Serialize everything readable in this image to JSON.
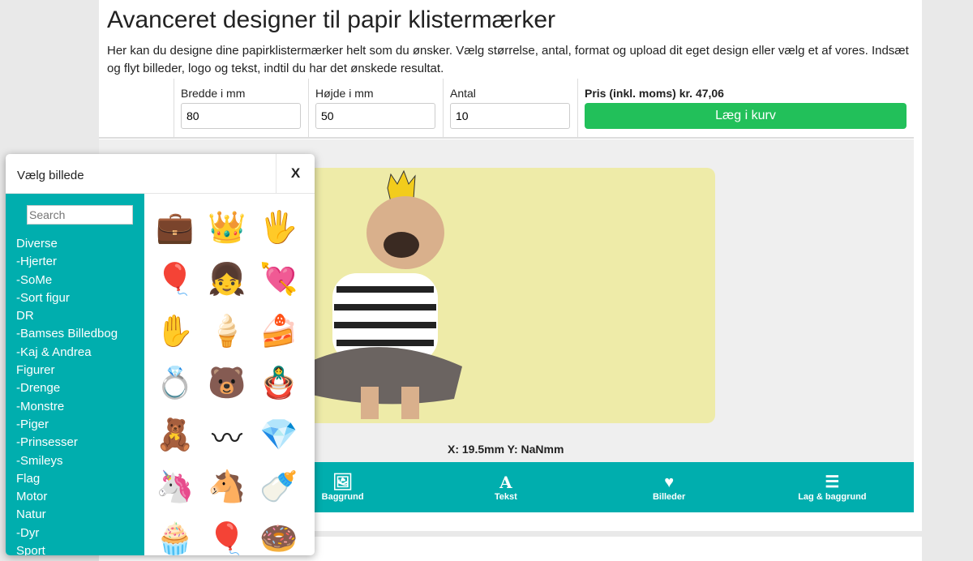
{
  "page": {
    "title": "Avanceret designer til papir klistermærker",
    "intro": "Her kan du designe dine papirklistermærker helt som du ønsker. Vælg størrelse, antal, format og upload dit eget design eller vælg et af vores. Indsæt og flyt billeder, logo og tekst, indtil du har det ønskede resultat."
  },
  "form": {
    "width_label": "Bredde i mm",
    "width_value": "80",
    "height_label": "Højde i mm",
    "height_value": "50",
    "qty_label": "Antal",
    "qty_value": "10",
    "price": "Pris (inkl. moms) kr. 47,06",
    "cart_label": "Læg i kurv"
  },
  "canvas": {
    "coords": "X: 19.5mm Y: NaNmm",
    "sticker_bg": "#eeeba8"
  },
  "toolbar": {
    "items": [
      {
        "label": "Baggrund",
        "icon": "image-icon"
      },
      {
        "label": "Tekst",
        "icon": "text-icon"
      },
      {
        "label": "Billeder",
        "icon": "heart-icon"
      },
      {
        "label": "Lag & baggrund",
        "icon": "list-icon"
      }
    ]
  },
  "popup": {
    "title": "Vælg billede",
    "close": "X",
    "search_placeholder": "Search",
    "categories": [
      "Diverse",
      "-Hjerter",
      "-SoMe",
      "-Sort figur",
      "DR",
      "-Bamses Billedbog",
      "-Kaj & Andrea",
      "Figurer",
      "-Drenge",
      "-Monstre",
      "-Piger",
      "-Prinsesser",
      "-Smileys",
      "Flag",
      "Motor",
      "Natur",
      "-Dyr",
      "Sport"
    ],
    "images": [
      {
        "icon": "briefcase",
        "g": "💼"
      },
      {
        "icon": "crown",
        "g": "👑"
      },
      {
        "icon": "hamsa",
        "g": "🖐"
      },
      {
        "icon": "heart-balloon",
        "g": "🎈"
      },
      {
        "icon": "kids",
        "g": "👧"
      },
      {
        "icon": "cupid",
        "g": "💘"
      },
      {
        "icon": "hamsa-blue",
        "g": "✋"
      },
      {
        "icon": "ice-cream",
        "g": "🍦"
      },
      {
        "icon": "cake-slice",
        "g": "🍰"
      },
      {
        "icon": "ring",
        "g": "💍"
      },
      {
        "icon": "bear",
        "g": "🐻"
      },
      {
        "icon": "matryoshka",
        "g": "🪆"
      },
      {
        "icon": "teddy",
        "g": "🧸"
      },
      {
        "icon": "mustache",
        "g": "〰"
      },
      {
        "icon": "diamond",
        "g": "💎"
      },
      {
        "icon": "unicorn",
        "g": "🦄"
      },
      {
        "icon": "dala-horse",
        "g": "🐴"
      },
      {
        "icon": "pacifier",
        "g": "🍼"
      },
      {
        "icon": "cupcake",
        "g": "🧁"
      },
      {
        "icon": "hot-air-balloon",
        "g": "🎈"
      },
      {
        "icon": "donut",
        "g": "🍩"
      }
    ]
  },
  "colors": {
    "teal": "#00aeae",
    "green": "#22c05a"
  }
}
